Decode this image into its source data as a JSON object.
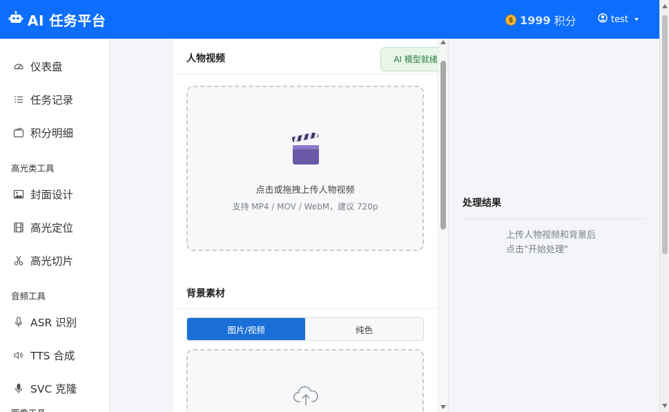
{
  "header": {
    "title": "AI 任务平台",
    "points_value": "1999",
    "points_unit": "积分",
    "username": "test"
  },
  "sidebar": {
    "items": [
      {
        "label": "仪表盘",
        "icon": "dashboard-icon"
      },
      {
        "label": "任务记录",
        "icon": "list-icon"
      },
      {
        "label": "积分明细",
        "icon": "wallet-icon"
      }
    ],
    "sections": [
      {
        "title": "高光类工具",
        "items": [
          {
            "label": "封面设计",
            "icon": "image-icon"
          },
          {
            "label": "高光定位",
            "icon": "film-icon"
          },
          {
            "label": "高光切片",
            "icon": "scissors-icon"
          }
        ]
      },
      {
        "title": "音频工具",
        "items": [
          {
            "label": "ASR 识别",
            "icon": "microphone-icon"
          },
          {
            "label": "TTS 合成",
            "icon": "speaker-icon"
          },
          {
            "label": "SVC 克隆",
            "icon": "mic-filled-icon"
          }
        ]
      },
      {
        "title": "图像工具",
        "items": []
      }
    ]
  },
  "main": {
    "video_card": {
      "title": "人物视频",
      "upload_text": "点击或拖拽上传人物视频",
      "upload_hint": "支持 MP4 / MOV / WebM，建议 720p"
    },
    "toast": "AI 模型就绪",
    "background_card": {
      "title": "背景素材",
      "tabs": [
        "图片/视频",
        "纯色"
      ],
      "active_tab": 0
    }
  },
  "result": {
    "title": "处理结果",
    "hint_line1": "上传人物视频和背景后",
    "hint_line2": "点击\"开始处理\""
  },
  "colors": {
    "header_bg": "#0d6efd",
    "accent": "#1a6fd6",
    "toast_bg": "#e8f6ea",
    "toast_text": "#2c7a3e"
  }
}
